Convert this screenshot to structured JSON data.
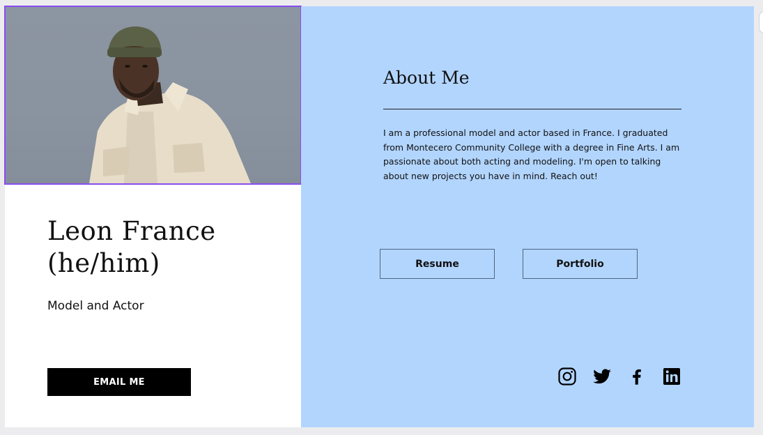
{
  "profile": {
    "name_line1": "Leon France",
    "name_line2": "(he/him)",
    "role": "Model and Actor",
    "email_button": "EMAIL ME",
    "photo_icon": "portrait-photo"
  },
  "about": {
    "title": "About Me",
    "bio": "I am a professional model and actor based in France. I graduated from Montecero Community College with a degree in Fine Arts. I am passionate about both acting and modeling. I'm open to talking about new projects you have in mind. Reach out!",
    "buttons": {
      "resume": "Resume",
      "portfolio": "Portfolio"
    }
  },
  "social": [
    {
      "icon": "instagram-icon"
    },
    {
      "icon": "twitter-icon"
    },
    {
      "icon": "facebook-icon"
    },
    {
      "icon": "linkedin-icon"
    }
  ],
  "colors": {
    "right_panel": "#b2d5fe",
    "left_panel": "#ffffff",
    "photo_border": "#8a4cf0",
    "email_button_bg": "#000000",
    "text": "#111111"
  }
}
